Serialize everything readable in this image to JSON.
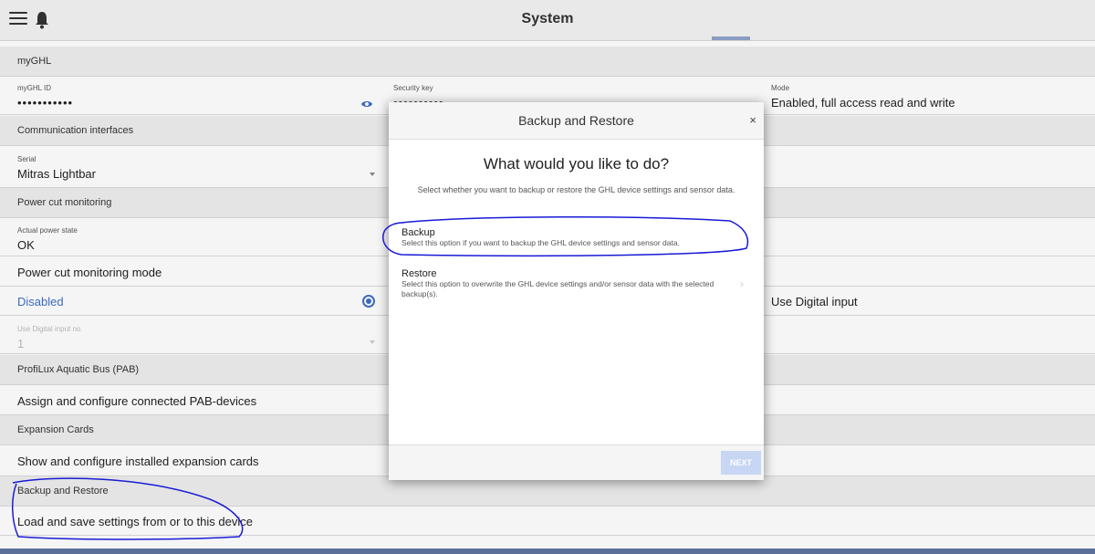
{
  "header": {
    "title": "System"
  },
  "sections": {
    "myghl": "myGHL",
    "comm": "Communication interfaces",
    "power": "Power cut monitoring",
    "pab": "ProfiLux Aquatic Bus (PAB)",
    "expansion": "Expansion Cards",
    "backup": "Backup and Restore"
  },
  "myghl": {
    "id_label": "myGHL ID",
    "id_value": "•••••••••••",
    "key_label": "Security key",
    "key_value": "••••••••••",
    "mode_label": "Mode",
    "mode_value": "Enabled, full access read and write"
  },
  "comm": {
    "serial_label": "Serial",
    "serial_value": "Mitras Lightbar"
  },
  "power": {
    "state_label": "Actual power state",
    "state_value": "OK",
    "mode_title": "Power cut monitoring mode",
    "opt_disabled": "Disabled",
    "opt_digital": "Use Digital input",
    "input_label": "Use Digital input no.",
    "input_value": "1"
  },
  "pab": {
    "link": "Assign and configure connected PAB-devices"
  },
  "expansion": {
    "link": "Show and configure installed expansion cards"
  },
  "backup": {
    "link": "Load and save settings from or to this device"
  },
  "modal": {
    "title": "Backup and Restore",
    "close": "×",
    "question": "What would you like to do?",
    "subtitle": "Select whether you want to backup or restore the GHL device settings and sensor data.",
    "backup_title": "Backup",
    "backup_desc": "Select this option if you want to backup the GHL device settings and sensor data.",
    "restore_title": "Restore",
    "restore_desc": "Select this option to overwrite the GHL device settings and/or sensor data with the selected backup(s).",
    "chevron": "›",
    "next": "NEXT"
  },
  "colors": {
    "accent": "#3f6fc5",
    "next_disabled": "#c7d6f3",
    "annotation": "#1a1ad6"
  },
  "icons": [
    "menu-icon",
    "bell-icon",
    "eye-icon",
    "radio-selected-icon",
    "chevron-right-icon",
    "close-icon",
    "dropdown-caret-icon"
  ]
}
